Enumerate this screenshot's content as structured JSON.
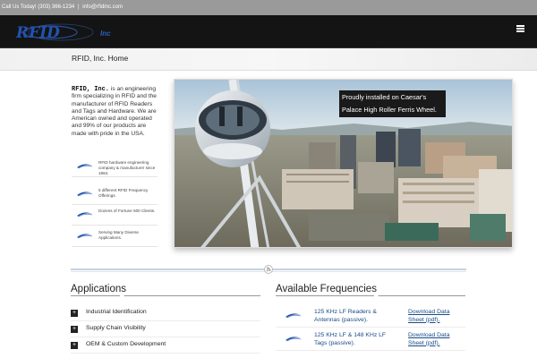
{
  "topbar": {
    "call_label": "Call Us Today! (303) 366-1234",
    "separator": "|",
    "email": "info@rfidinc.com"
  },
  "header": {
    "logo_text": "RFID",
    "logo_suffix": "Inc"
  },
  "page": {
    "title": "RFID, Inc. Home"
  },
  "intro": {
    "company": "RFID, Inc.",
    "text": "is an engineering firm specializing in RFID and the manufacturer of RFID Readers and Tags and Hardware. We are American owned and operated and 99% of our products are made with pride in the USA."
  },
  "features": [
    {
      "text": "RFID hardware engineering company & manufacturer since 1984."
    },
    {
      "text": "5 different RFID Frequency Offerings."
    },
    {
      "text": "Dozens of Fortune 500 Clients."
    },
    {
      "text": "Serving Many Diverse Applications."
    }
  ],
  "hero": {
    "caption_line1": "Proudly installed on Caesar's",
    "caption_line2": "Palace High Roller Ferris Wheel."
  },
  "applications": {
    "heading": "Applications",
    "items": [
      {
        "label": "Industrial Identification"
      },
      {
        "label": "Supply Chain Visibility"
      },
      {
        "label": "OEM & Custom Development"
      }
    ]
  },
  "frequencies": {
    "heading": "Available Frequencies",
    "items": [
      {
        "label": "125 KHz LF Readers & Antennas (passive).",
        "link": "Download Data Sheet (pdf)."
      },
      {
        "label": "125 KHz LF & 148 KHz LF Tags (passive).",
        "link": "Download Data Sheet (pdf)."
      }
    ]
  },
  "colors": {
    "brand_blue": "#1f4fa8",
    "link_blue": "#1a4b88",
    "header_bg": "#141414"
  }
}
